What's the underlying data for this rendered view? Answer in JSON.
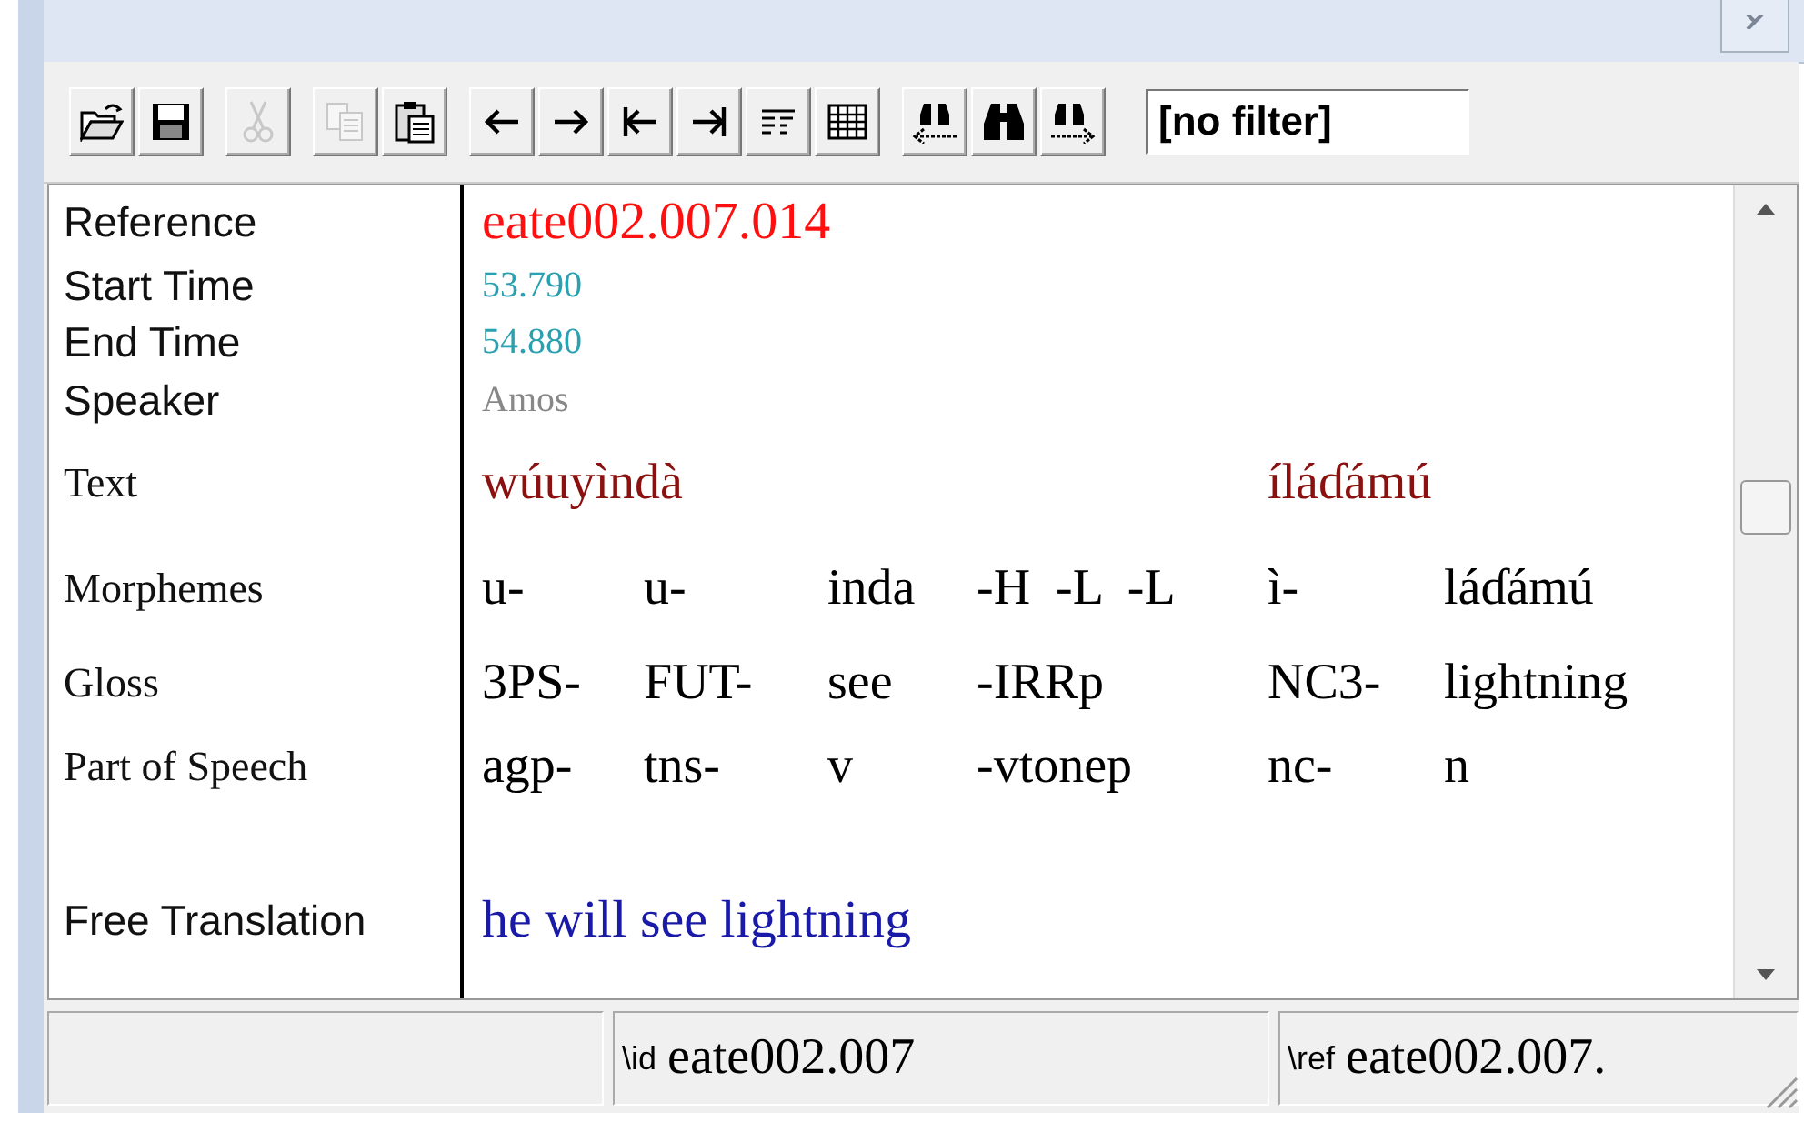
{
  "toolbar": [
    {
      "kind": "open",
      "disabled": false
    },
    {
      "kind": "save",
      "disabled": false
    },
    {
      "kind": "cut",
      "disabled": true
    },
    {
      "kind": "copy",
      "disabled": true
    },
    {
      "kind": "paste",
      "disabled": false
    },
    {
      "kind": "prev",
      "disabled": false
    },
    {
      "kind": "next",
      "disabled": false
    },
    {
      "kind": "first",
      "disabled": false
    },
    {
      "kind": "last",
      "disabled": false
    },
    {
      "kind": "list",
      "disabled": false
    },
    {
      "kind": "columns",
      "disabled": false
    },
    {
      "kind": "find-prev",
      "disabled": false
    },
    {
      "kind": "find",
      "disabled": false
    },
    {
      "kind": "find-next",
      "disabled": false
    }
  ],
  "filter": {
    "value": "[no filter]"
  },
  "fields": [
    {
      "kind": "reference",
      "label": "Reference",
      "value": "eate002.007.014"
    },
    {
      "kind": "time",
      "label": "Start Time",
      "value": "53.790"
    },
    {
      "kind": "time",
      "label": "End Time",
      "value": "54.880"
    },
    {
      "kind": "speaker",
      "label": "Speaker",
      "value": "Amos"
    }
  ],
  "interlinear": {
    "labels": [
      "Text",
      "Morphemes",
      "Gloss",
      "Part of Speech"
    ],
    "words": [
      {
        "text": "wúuyìndà",
        "morphemes": [
          {
            "form": "u-",
            "gloss": "3PS-",
            "pos": "agp-"
          },
          {
            "form": "u-",
            "gloss": "FUT-",
            "pos": "tns-"
          },
          {
            "form": "inda",
            "gloss": "see",
            "pos": "v"
          },
          {
            "form": "-H  -L  -L",
            "gloss": "-IRRp",
            "pos": "-vtonep"
          }
        ]
      },
      {
        "text": "íláɗámú",
        "morphemes": [
          {
            "form": "ì-",
            "gloss": "NC3-",
            "pos": "nc-"
          },
          {
            "form": "láɗámú",
            "gloss": "lightning",
            "pos": "n"
          }
        ]
      }
    ]
  },
  "free_translation": {
    "label": "Free Translation",
    "value": "he will see lightning"
  },
  "status_bar": [
    {
      "marker": "\\id",
      "value": "eate002.007"
    },
    {
      "marker": "\\ref",
      "value": "eate002.007."
    }
  ]
}
